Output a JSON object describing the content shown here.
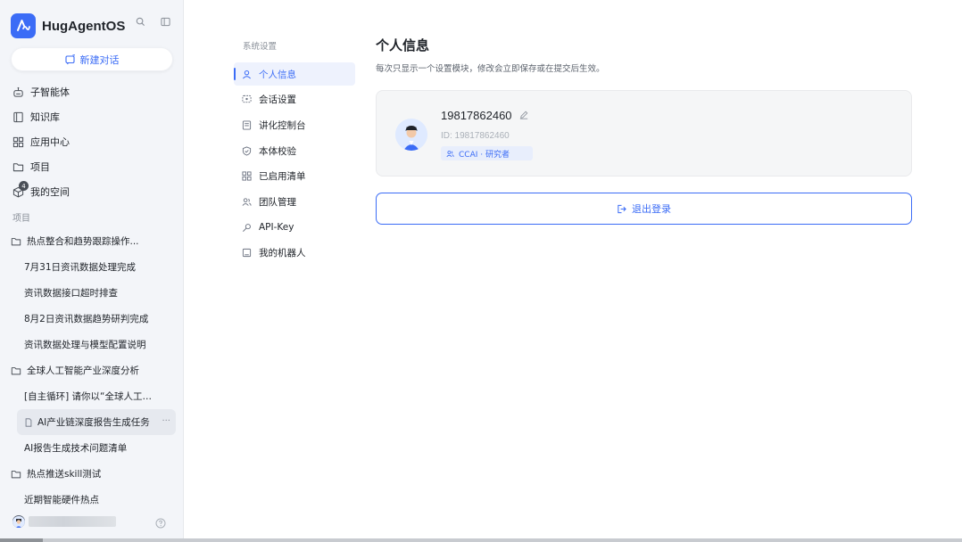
{
  "app": {
    "name": "HugAgentOS"
  },
  "sidebar": {
    "new_chat_label": "新建对话",
    "nav": [
      {
        "label": "子智能体",
        "icon": "robot-icon"
      },
      {
        "label": "知识库",
        "icon": "book-icon"
      },
      {
        "label": "应用中心",
        "icon": "apps-grid-icon"
      },
      {
        "label": "项目",
        "icon": "folder-icon"
      },
      {
        "label": "我的空间",
        "icon": "cube-icon",
        "badge": "4"
      }
    ],
    "projects_label": "项目",
    "projects": [
      {
        "name": "热点整合和趋势跟踪操作...",
        "tasks": [
          {
            "label": "7月31日资讯数据处理完成"
          },
          {
            "label": "资讯数据接口超时排查"
          },
          {
            "label": "8月2日资讯数据趋势研判完成"
          },
          {
            "label": "资讯数据处理与模型配置说明"
          }
        ]
      },
      {
        "name": "全球人工智能产业深度分析",
        "tasks": [
          {
            "label": "[自主循环] 请你以“全球人工智..."
          },
          {
            "label": "AI产业链深度报告生成任务",
            "active": true,
            "more": "···"
          },
          {
            "label": "AI报告生成技术问题清单"
          }
        ]
      },
      {
        "name": "热点推送skill测试",
        "tasks": [
          {
            "label": "近期智能硬件热点"
          }
        ]
      }
    ]
  },
  "settings": {
    "title": "系统设置",
    "items": [
      {
        "label": "个人信息",
        "icon": "user-icon",
        "active": true
      },
      {
        "label": "会话设置",
        "icon": "chat-settings-icon"
      },
      {
        "label": "讲化控制台",
        "icon": "console-icon"
      },
      {
        "label": "本体校验",
        "icon": "shield-icon"
      },
      {
        "label": "已启用清单",
        "icon": "grid-list-icon"
      },
      {
        "label": "团队管理",
        "icon": "team-icon"
      },
      {
        "label": "API-Key",
        "icon": "key-icon"
      },
      {
        "label": "我的机器人",
        "icon": "bot-icon"
      }
    ]
  },
  "profile": {
    "heading": "个人信息",
    "description": "每次只显示一个设置模块，修改会立即保存或在提交后生效。",
    "phone": "19817862460",
    "id_text": "ID: 19817862460",
    "role": "CCAI · 研究者",
    "logout_label": "退出登录"
  },
  "colors": {
    "accent": "#3b6cf6",
    "sidebar_bg": "#f3f5f9",
    "card_bg": "#f5f6f7"
  }
}
